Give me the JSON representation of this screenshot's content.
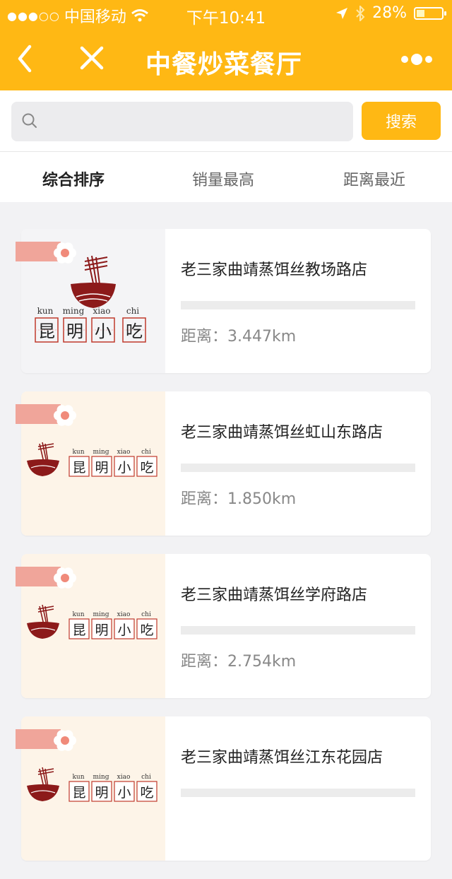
{
  "status": {
    "carrier": "中国移动",
    "time": "下午10:41",
    "battery": "28%",
    "battery_level": 0.28
  },
  "nav": {
    "title": "中餐炒菜餐厅",
    "back_icon": "back-arrow-icon",
    "close_icon": "close-icon",
    "more_icon": "more-dots-icon"
  },
  "search": {
    "placeholder": "",
    "button_label": "搜索"
  },
  "tabs": [
    {
      "label": "综合排序",
      "active": true
    },
    {
      "label": "销量最高",
      "active": false
    },
    {
      "label": "距离最近",
      "active": false
    }
  ],
  "stores": [
    {
      "name": "老三家曲靖蒸饵丝教场路店",
      "distance": "距离：3.447km"
    },
    {
      "name": "老三家曲靖蒸饵丝虹山东路店",
      "distance": "距离：1.850km"
    },
    {
      "name": "老三家曲靖蒸饵丝学府路店",
      "distance": "距离：2.754km"
    },
    {
      "name": "老三家曲靖蒸饵丝江东花园店",
      "distance": ""
    }
  ],
  "logo": {
    "pinyin": [
      "kun",
      "ming",
      "xiao",
      "chi"
    ],
    "chars": [
      "昆",
      "明",
      "小",
      "吃"
    ]
  },
  "colors": {
    "accent": "#ffb814",
    "bowl": "#8c1a1a",
    "ribbon": "#f0a59a"
  }
}
